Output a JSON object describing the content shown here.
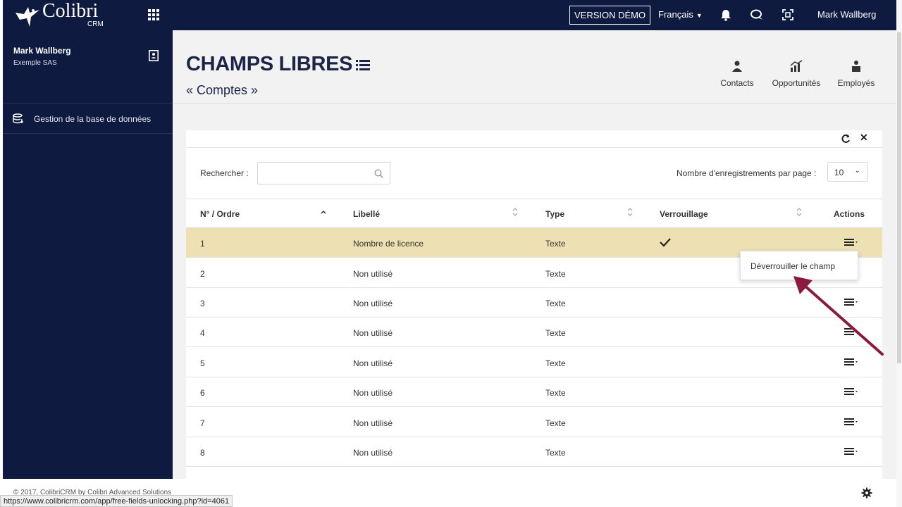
{
  "topbar": {
    "logo_text": "Colibri",
    "logo_sub": "CRM",
    "demo_label": "VERSION DÉMO",
    "language": "Français",
    "user_name": "Mark Wallberg",
    "icons": [
      "apps-grid-icon",
      "bell-icon",
      "chat-icon",
      "fullscreen-icon"
    ]
  },
  "sidebar": {
    "user_name": "Mark Wallberg",
    "company": "Exemple SAS",
    "items": [
      {
        "label": "Gestion de la base de données",
        "icon": "database-icon"
      }
    ]
  },
  "header": {
    "title": "CHAMPS LIBRES",
    "subtitle": "« Comptes »",
    "quick_links": [
      {
        "label": "Contacts",
        "icon": "contacts-icon"
      },
      {
        "label": "Opportunités",
        "icon": "chart-icon"
      },
      {
        "label": "Employés",
        "icon": "employee-icon"
      }
    ]
  },
  "panel": {
    "search_label": "Rechercher :",
    "search_value": "",
    "per_page_label": "Nombre d'enregistrements par page :",
    "per_page_value": "10",
    "columns": [
      "N° / Ordre",
      "Libellé",
      "Type",
      "Verrouillage",
      "Actions"
    ],
    "rows": [
      {
        "num": "1",
        "label": "Nombre de licence",
        "type": "Texte",
        "locked": true
      },
      {
        "num": "2",
        "label": "Non utilisé",
        "type": "Texte",
        "locked": false
      },
      {
        "num": "3",
        "label": "Non utilisé",
        "type": "Texte",
        "locked": false
      },
      {
        "num": "4",
        "label": "Non utilisé",
        "type": "Texte",
        "locked": false
      },
      {
        "num": "5",
        "label": "Non utilisé",
        "type": "Texte",
        "locked": false
      },
      {
        "num": "6",
        "label": "Non utilisé",
        "type": "Texte",
        "locked": false
      },
      {
        "num": "7",
        "label": "Non utilisé",
        "type": "Texte",
        "locked": false
      },
      {
        "num": "8",
        "label": "Non utilisé",
        "type": "Texte",
        "locked": false
      }
    ],
    "dropdown_item": "Déverrouiller le champ"
  },
  "footer": {
    "copyright": "© 2017, ColibriCRM by Colibri Advanced Solutions",
    "status_url": "https://www.colibricrm.com/app/free-fields-unlocking.php?id=4061"
  },
  "colors": {
    "navy": "#0e1a3f",
    "highlight_row": "#ede0b3",
    "annotation_arrow": "#8b1a3c"
  }
}
